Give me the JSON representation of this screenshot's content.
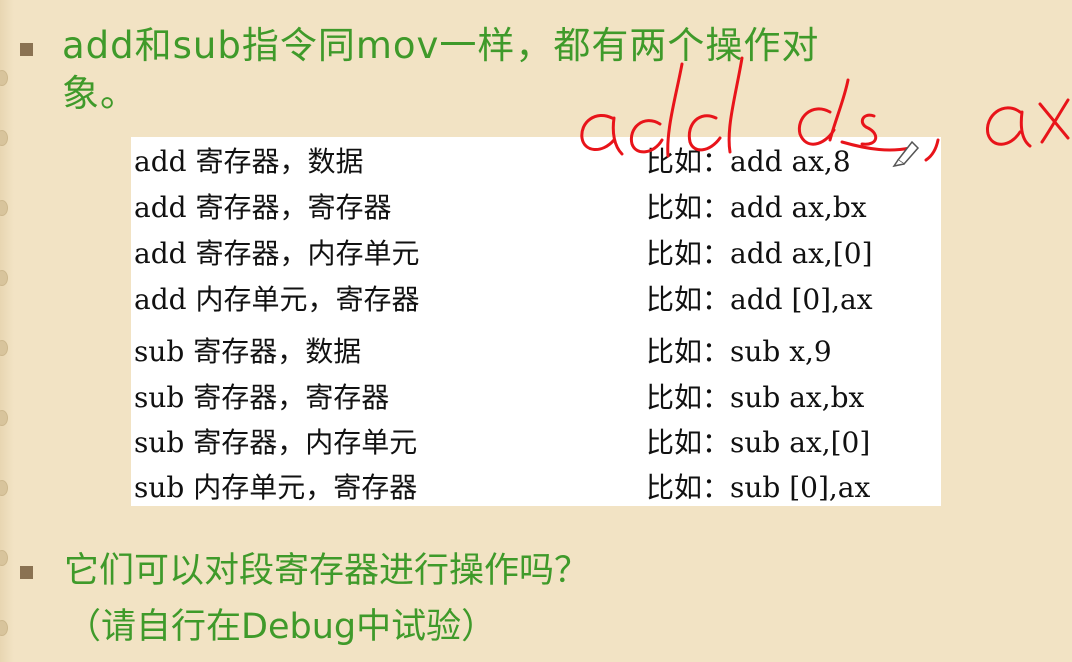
{
  "slide": {
    "bullet1_text_line1": "add和sub指令同mov一样，都有两个操作对",
    "bullet1_text_line2": "象。",
    "bullet2_text": "它们可以对段寄存器进行操作吗？",
    "bullet2_note": "（请自行在Debug中试验）"
  },
  "instruction_table": {
    "rows": [
      {
        "form": "add 寄存器，数据",
        "example": "比如：add ax,8"
      },
      {
        "form": "add 寄存器，寄存器",
        "example": "比如：add ax,bx"
      },
      {
        "form": "add 寄存器，内存单元",
        "example": "比如：add ax,[0]"
      },
      {
        "form": "add 内存单元，寄存器",
        "example": "比如：add [0],ax"
      },
      {
        "form": "sub 寄存器，数据",
        "example": "比如：sub x,9"
      },
      {
        "form": "sub 寄存器，寄存器",
        "example": "比如：sub ax,bx"
      },
      {
        "form": "sub 寄存器，内存单元",
        "example": "比如：sub ax,[0]"
      },
      {
        "form": "sub 内存单元，寄存器",
        "example": "比如：sub [0],ax"
      }
    ]
  },
  "annotation": {
    "handwritten_text": "add ds, ax",
    "ink_color": "#e8141a"
  },
  "colors": {
    "background": "#f2e3c4",
    "heading_green": "#3f9a2a",
    "bullet_brown": "#8a7252",
    "table_bg": "#ffffff"
  }
}
